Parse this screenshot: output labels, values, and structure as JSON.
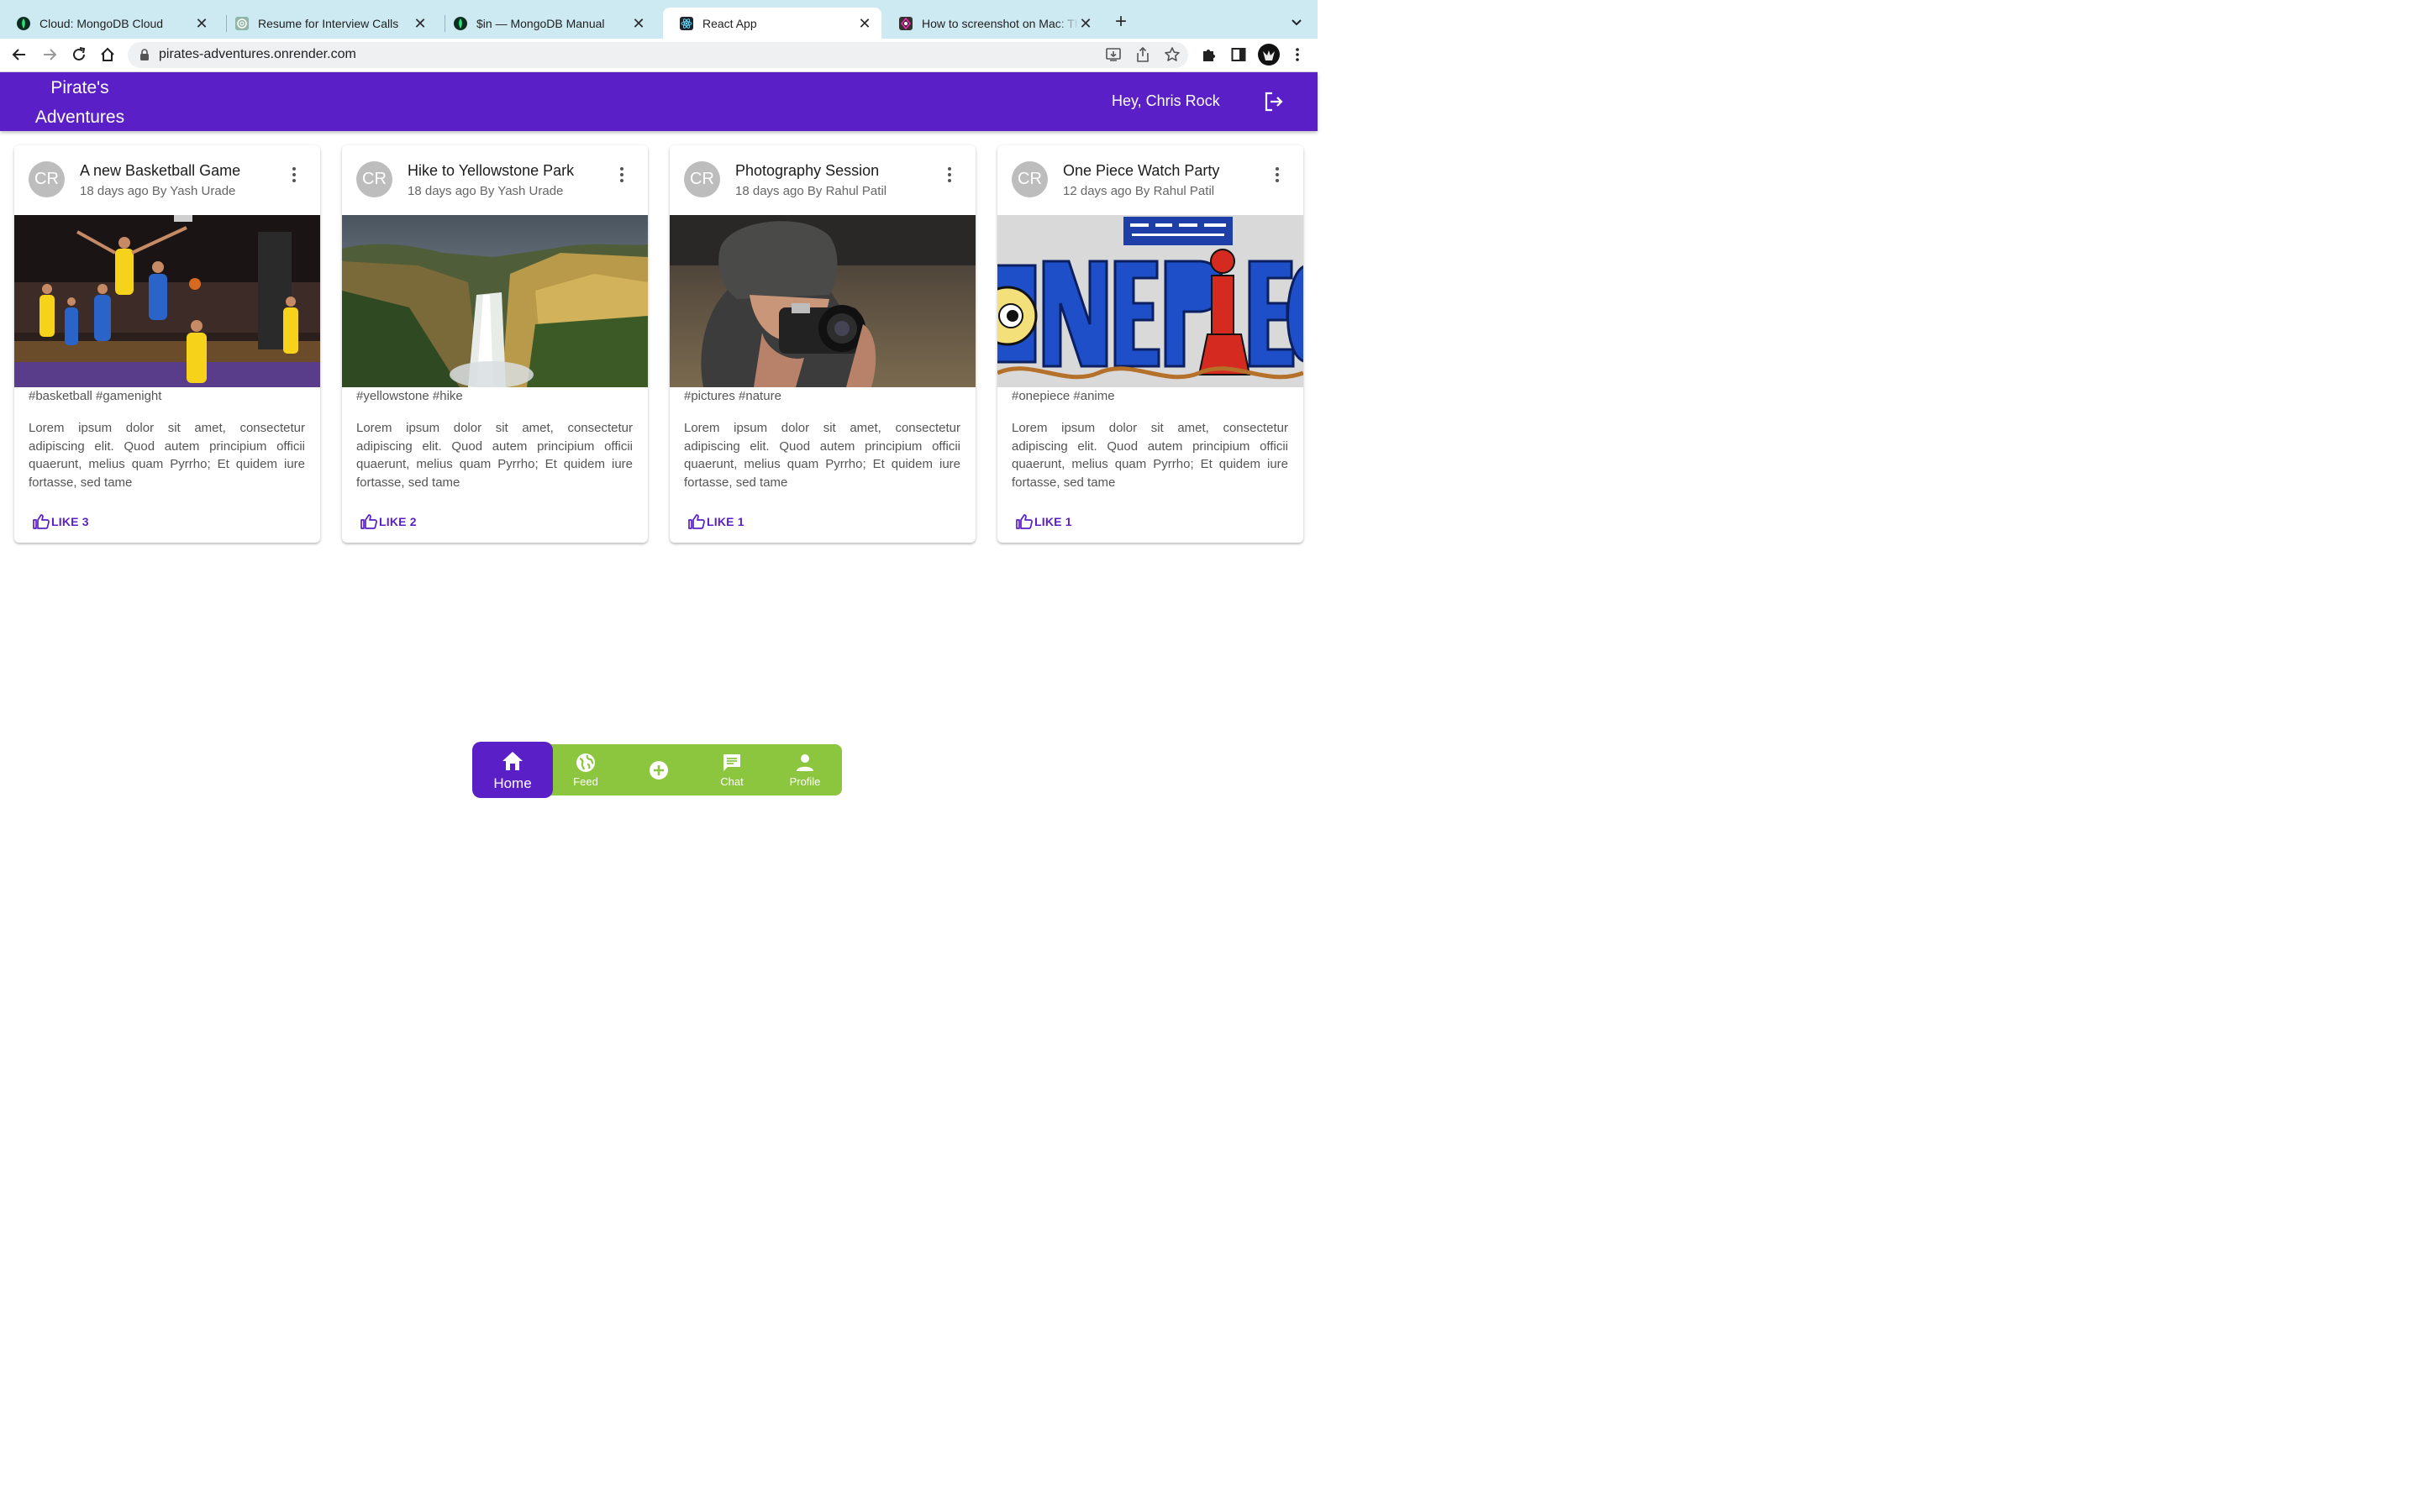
{
  "browser": {
    "tabs": [
      {
        "title": "Cloud: MongoDB Cloud",
        "icon": "mongodb-leaf-icon",
        "active": false
      },
      {
        "title": "Resume for Interview Calls",
        "icon": "chatgpt-icon",
        "active": false
      },
      {
        "title": "$in — MongoDB Manual",
        "icon": "mongodb-leaf-icon",
        "active": false
      },
      {
        "title": "React App",
        "icon": "react-icon",
        "active": true
      },
      {
        "title": "How to screenshot on Mac: The",
        "icon": "site-icon",
        "active": false
      }
    ],
    "new_tab_label": "+",
    "close_glyph": "✕",
    "url": "pirates-adventures.onrender.com"
  },
  "header": {
    "brand_line1": "Pirate's",
    "brand_line2": "Adventures",
    "greeting": "Hey, Chris Rock",
    "logout_icon": "logout-icon",
    "bar_color": "#5a1fc6"
  },
  "posts": [
    {
      "avatar": "CR",
      "title": "A new Basketball Game",
      "meta": "18 days ago By Yash Urade",
      "image": "basketball-game-photo",
      "tags": "#basketball #gamenight",
      "body": "Lorem ipsum dolor sit amet, consectetur adipiscing elit. Quod autem principium officii quaerunt, melius quam Pyrrho; Et quidem iure fortasse, sed tame",
      "like_label": "LIKE 3"
    },
    {
      "avatar": "CR",
      "title": "Hike to Yellowstone Park",
      "meta": "18 days ago By Yash Urade",
      "image": "yellowstone-waterfall-photo",
      "tags": "#yellowstone #hike",
      "body": "Lorem ipsum dolor sit amet, consectetur adipiscing elit. Quod autem principium officii quaerunt, melius quam Pyrrho; Et quidem iure fortasse, sed tame",
      "like_label": "LIKE 2"
    },
    {
      "avatar": "CR",
      "title": "Photography Session",
      "meta": "18 days ago By Rahul Patil",
      "image": "photographer-photo",
      "tags": "#pictures #nature",
      "body": "Lorem ipsum dolor sit amet, consectetur adipiscing elit. Quod autem principium officii quaerunt, melius quam Pyrrho; Et quidem iure fortasse, sed tame",
      "like_label": "LIKE 1"
    },
    {
      "avatar": "CR",
      "title": "One Piece Watch Party",
      "meta": "12 days ago By Rahul Patil",
      "image": "one-piece-logo-image",
      "tags": "#onepiece #anime",
      "body": "Lorem ipsum dolor sit amet, consectetur adipiscing elit. Quod autem principium officii quaerunt, melius quam Pyrrho; Et quidem iure fortasse, sed tame",
      "like_label": "LIKE 1"
    }
  ],
  "bottom_nav": {
    "items": [
      {
        "label": "Home",
        "icon": "home-icon",
        "active": true
      },
      {
        "label": "Feed",
        "icon": "globe-icon"
      },
      {
        "label": "",
        "icon": "add-circle-icon"
      },
      {
        "label": "Chat",
        "icon": "chat-icon"
      },
      {
        "label": "Profile",
        "icon": "person-icon"
      }
    ],
    "active_color": "#5a1fc6",
    "bar_color": "#8cc63f"
  }
}
